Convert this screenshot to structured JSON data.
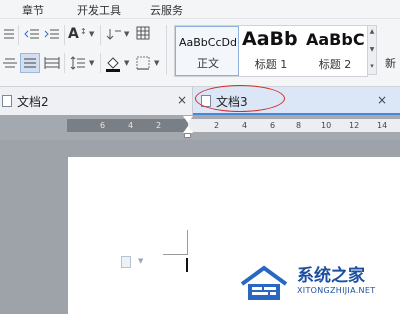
{
  "menu": {
    "items": [
      "章节",
      "开发工具",
      "云服务"
    ]
  },
  "ribbon": {
    "font_grow_label": "A",
    "styles": [
      {
        "preview": "AaBbCcDd",
        "label": "正文"
      },
      {
        "preview": "AaBb",
        "label": "标题 1"
      },
      {
        "preview": "AaBbC",
        "label": "标题 2"
      }
    ],
    "new_style_label": "新"
  },
  "tabs": [
    {
      "label": "文档2",
      "close": "×"
    },
    {
      "label": "文档3",
      "close": "×"
    }
  ],
  "ruler": {
    "ticks": [
      "6",
      "4",
      "2",
      "2",
      "4",
      "6",
      "8",
      "10",
      "12",
      "14"
    ]
  },
  "watermark": {
    "title": "系统之家",
    "url": "XITONGZHIJIA.NET"
  },
  "colors": {
    "active_tab": "#dbe6f7",
    "highlight_ellipse": "#d62a2a",
    "watermark": "#1c4f9e"
  }
}
